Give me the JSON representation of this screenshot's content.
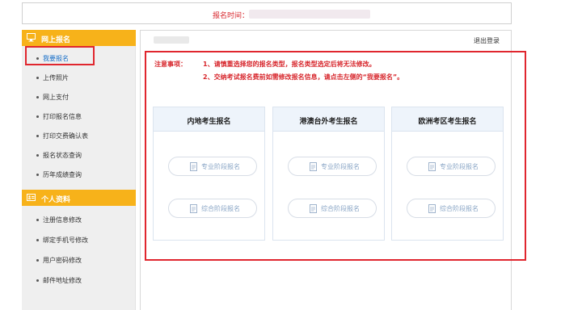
{
  "header": {
    "time_label": "报名时间："
  },
  "sidebar": {
    "sections": [
      {
        "title": "网上报名",
        "items": [
          "我要报名",
          "上传照片",
          "网上支付",
          "打印报名信息",
          "打印交费确认表",
          "报名状态查询",
          "历年成绩查询"
        ]
      },
      {
        "title": "个人资料",
        "items": [
          "注册信息修改",
          "绑定手机号修改",
          "用户密码修改",
          "邮件地址修改"
        ]
      }
    ],
    "active_item": "我要报名"
  },
  "main": {
    "logout_label": "退出登录",
    "notice": {
      "title": "注意事项：",
      "lines": [
        "1、请慎重选择您的报名类型，报名类型选定后将无法修改。",
        "2、交纳考试报名费前如需修改报名信息，请点击左侧的“我要报名”。"
      ]
    },
    "cards": [
      {
        "title": "内地考生报名",
        "buttons": [
          "专业阶段报名",
          "综合阶段报名"
        ]
      },
      {
        "title": "港澳台外考生报名",
        "buttons": [
          "专业阶段报名",
          "综合阶段报名"
        ]
      },
      {
        "title": "欧洲考区考生报名",
        "buttons": [
          "专业阶段报名",
          "综合阶段报名"
        ]
      }
    ]
  },
  "icons": {
    "section_1": "monitor-icon",
    "section_2": "id-card-icon",
    "button": "document-icon"
  },
  "colors": {
    "accent_orange": "#f7b21a",
    "highlight_red": "#e0262e",
    "link_blue": "#1a70c8"
  }
}
